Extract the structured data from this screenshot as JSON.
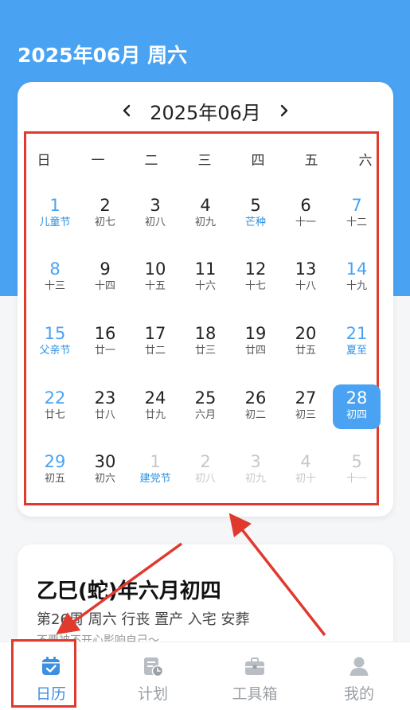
{
  "header": {
    "title": "2025年06月 周六"
  },
  "calendar": {
    "month_label": "2025年06月",
    "weekdays": [
      "日",
      "一",
      "二",
      "三",
      "四",
      "五",
      "六"
    ],
    "weeks": [
      [
        {
          "d": "1",
          "s": "儿童节",
          "fest": true
        },
        {
          "d": "2",
          "s": "初七"
        },
        {
          "d": "3",
          "s": "初八"
        },
        {
          "d": "4",
          "s": "初九"
        },
        {
          "d": "5",
          "s": "芒种",
          "fest": true
        },
        {
          "d": "6",
          "s": "十一"
        },
        {
          "d": "7",
          "s": "十二"
        }
      ],
      [
        {
          "d": "8",
          "s": "十三"
        },
        {
          "d": "9",
          "s": "十四"
        },
        {
          "d": "10",
          "s": "十五"
        },
        {
          "d": "11",
          "s": "十六"
        },
        {
          "d": "12",
          "s": "十七"
        },
        {
          "d": "13",
          "s": "十八"
        },
        {
          "d": "14",
          "s": "十九"
        }
      ],
      [
        {
          "d": "15",
          "s": "父亲节",
          "fest": true
        },
        {
          "d": "16",
          "s": "廿一"
        },
        {
          "d": "17",
          "s": "廿二"
        },
        {
          "d": "18",
          "s": "廿三"
        },
        {
          "d": "19",
          "s": "廿四"
        },
        {
          "d": "20",
          "s": "廿五"
        },
        {
          "d": "21",
          "s": "夏至",
          "fest": true
        }
      ],
      [
        {
          "d": "22",
          "s": "廿七"
        },
        {
          "d": "23",
          "s": "廿八"
        },
        {
          "d": "24",
          "s": "廿九"
        },
        {
          "d": "25",
          "s": "六月"
        },
        {
          "d": "26",
          "s": "初二"
        },
        {
          "d": "27",
          "s": "初三"
        },
        {
          "d": "28",
          "s": "初四",
          "selected": true
        }
      ],
      [
        {
          "d": "29",
          "s": "初五"
        },
        {
          "d": "30",
          "s": "初六"
        },
        {
          "d": "1",
          "s": "建党节",
          "fest": true,
          "out": true
        },
        {
          "d": "2",
          "s": "初八",
          "out": true
        },
        {
          "d": "3",
          "s": "初九",
          "out": true
        },
        {
          "d": "4",
          "s": "初十",
          "out": true
        },
        {
          "d": "5",
          "s": "十一",
          "out": true
        }
      ]
    ]
  },
  "info": {
    "lunar_title": "乙巳(蛇)年六月初四",
    "lunar_sub": "第26周 周六 行丧 置产 入宅 安葬",
    "extra": "不要被不开心影响自己～"
  },
  "bottom_nav": [
    {
      "label": "日历",
      "icon": "calendar-icon",
      "active": true
    },
    {
      "label": "计划",
      "icon": "plan-icon",
      "active": false
    },
    {
      "label": "工具箱",
      "icon": "toolbox-icon",
      "active": false
    },
    {
      "label": "我的",
      "icon": "user-icon",
      "active": false
    }
  ],
  "colors": {
    "accent": "#4aa3f2",
    "highlight_box": "#e03a2e"
  }
}
